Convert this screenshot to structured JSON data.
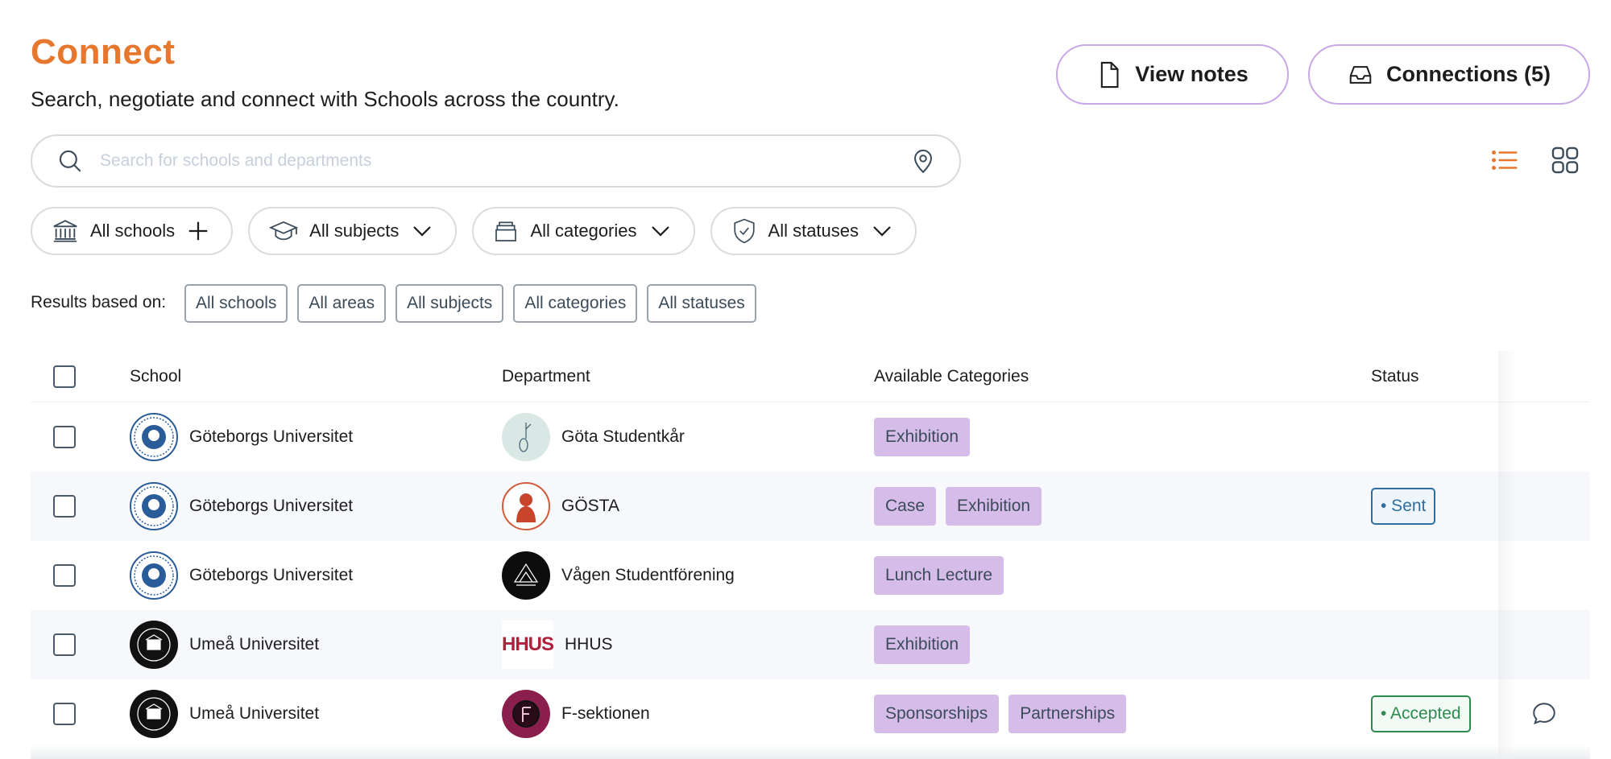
{
  "header": {
    "title": "Connect",
    "subtitle": "Search, negotiate and connect with Schools across the country.",
    "view_notes_label": "View notes",
    "connections_label": "Connections (5)"
  },
  "search": {
    "placeholder": "Search for schools and departments",
    "value": ""
  },
  "view_toggle": {
    "active": "list",
    "list_icon": "list-icon",
    "grid_icon": "grid-icon"
  },
  "filters": [
    {
      "label": "All schools",
      "icon": "bank-icon",
      "trailing": "plus-icon"
    },
    {
      "label": "All subjects",
      "icon": "graduation-cap-icon",
      "trailing": "chevron-down-icon"
    },
    {
      "label": "All categories",
      "icon": "archive-box-icon",
      "trailing": "chevron-down-icon"
    },
    {
      "label": "All statuses",
      "icon": "shield-check-icon",
      "trailing": "chevron-down-icon"
    }
  ],
  "results": {
    "label": "Results based on:",
    "chips": [
      "All schools",
      "All areas",
      "All subjects",
      "All categories",
      "All statuses"
    ]
  },
  "table": {
    "columns": [
      "School",
      "Department",
      "Available Categories",
      "Status"
    ],
    "rows": [
      {
        "school": "Göteborgs Universitet",
        "department": "Göta Studentkår",
        "categories": [
          "Exhibition"
        ],
        "status": ""
      },
      {
        "school": "Göteborgs Universitet",
        "department": "GÖSTA",
        "categories": [
          "Case",
          "Exhibition"
        ],
        "status": "• Sent"
      },
      {
        "school": "Göteborgs Universitet",
        "department": "Vågen Studentförening",
        "categories": [
          "Lunch Lecture"
        ],
        "status": ""
      },
      {
        "school": "Umeå Universitet",
        "department": "HHUS",
        "categories": [
          "Exhibition"
        ],
        "status": ""
      },
      {
        "school": "Umeå Universitet",
        "department": "F-sektionen",
        "categories": [
          "Sponsorships",
          "Partnerships"
        ],
        "status": "• Accepted"
      }
    ]
  },
  "colors": {
    "accent": "#e8772e",
    "button_border": "#c9a8e6",
    "category_tag": "#d6bde9",
    "status_sent": "#2f6f9f",
    "status_accepted": "#2e8a4f"
  },
  "logo_text": {
    "hhus": "HHUS"
  }
}
